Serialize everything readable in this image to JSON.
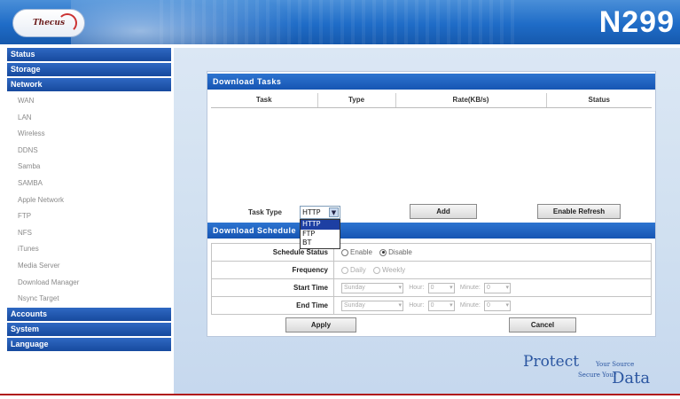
{
  "header": {
    "logo_text": "Thecus",
    "model": "N299"
  },
  "sidebar": {
    "categories": {
      "status": "Status",
      "storage": "Storage",
      "network": "Network",
      "accounts": "Accounts",
      "system": "System",
      "language": "Language"
    },
    "network_items": [
      "WAN",
      "LAN",
      "Wireless",
      "DDNS",
      "Samba",
      "SAMBA",
      "Apple Network",
      "FTP",
      "NFS",
      "iTunes",
      "Media Server",
      "Download Manager",
      "Nsync Target"
    ]
  },
  "download_tasks": {
    "title": "Download Tasks",
    "columns": [
      "Task",
      "Type",
      "Rate(KB/s)",
      "Status"
    ],
    "task_type_label": "Task Type",
    "task_type_value": "HTTP",
    "task_type_options": [
      "HTTP",
      "FTP",
      "BT"
    ],
    "add_label": "Add",
    "refresh_label": "Enable Refresh"
  },
  "download_schedule": {
    "title": "Download Schedule",
    "rows": {
      "schedule_status": {
        "label": "Schedule Status",
        "options": [
          "Enable",
          "Disable"
        ],
        "selected": "Disable"
      },
      "frequency": {
        "label": "Frequency",
        "options": [
          "Daily",
          "Weekly"
        ]
      },
      "start_time": {
        "label": "Start Time",
        "day": "Sunday",
        "hour_label": "Hour:",
        "hour": "0",
        "minute_label": "Minute:",
        "minute": "0"
      },
      "end_time": {
        "label": "End Time",
        "day": "Sunday",
        "hour_label": "Hour:",
        "hour": "0",
        "minute_label": "Minute:",
        "minute": "0"
      }
    },
    "apply_label": "Apply",
    "cancel_label": "Cancel"
  },
  "footer": {
    "protect": "Protect",
    "your_source": "Your Source",
    "secure_your": "Secure Your",
    "data": "Data"
  }
}
